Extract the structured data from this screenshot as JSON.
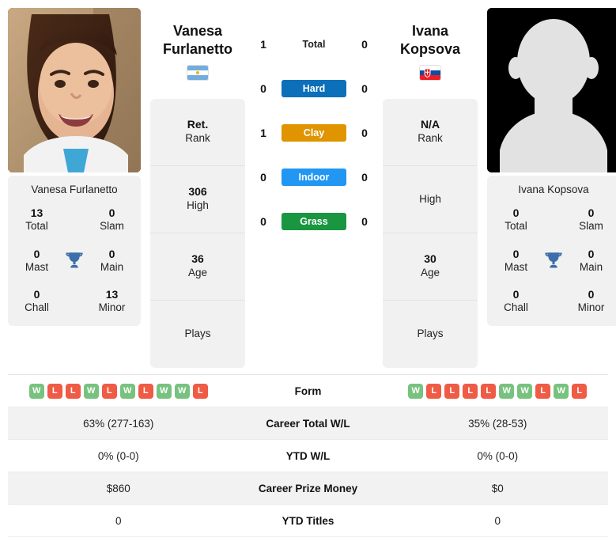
{
  "players": {
    "left": {
      "first_name": "Vanesa",
      "last_name": "Furlanetto",
      "full_name": "Vanesa Furlanetto",
      "country_flag_icon": "flag-argentina-icon",
      "photo_type": "player-photo",
      "rank": "Ret.",
      "rank_label": "Rank",
      "high": "306",
      "high_label": "High",
      "age": "36",
      "age_label": "Age",
      "plays": "",
      "plays_label": "Plays",
      "titles": {
        "total": "13",
        "total_label": "Total",
        "slam": "0",
        "slam_label": "Slam",
        "mast": "0",
        "mast_label": "Mast",
        "main": "0",
        "main_label": "Main",
        "chall": "0",
        "chall_label": "Chall",
        "minor": "13",
        "minor_label": "Minor"
      },
      "form": [
        "W",
        "L",
        "L",
        "W",
        "L",
        "W",
        "L",
        "W",
        "W",
        "L"
      ],
      "career_wl": "63% (277-163)",
      "ytd_wl": "0% (0-0)",
      "career_prize": "$860",
      "ytd_titles": "0"
    },
    "right": {
      "first_name": "Ivana",
      "last_name": "Kopsova",
      "full_name": "Ivana Kopsova",
      "country_flag_icon": "flag-slovakia-icon",
      "photo_type": "placeholder-avatar",
      "rank": "N/A",
      "rank_label": "Rank",
      "high": "",
      "high_label": "High",
      "age": "30",
      "age_label": "Age",
      "plays": "",
      "plays_label": "Plays",
      "titles": {
        "total": "0",
        "total_label": "Total",
        "slam": "0",
        "slam_label": "Slam",
        "mast": "0",
        "mast_label": "Mast",
        "main": "0",
        "main_label": "Main",
        "chall": "0",
        "chall_label": "Chall",
        "minor": "0",
        "minor_label": "Minor"
      },
      "form": [
        "W",
        "L",
        "L",
        "L",
        "L",
        "W",
        "W",
        "L",
        "W",
        "L"
      ],
      "career_wl": "35% (28-53)",
      "ytd_wl": "0% (0-0)",
      "career_prize": "$0",
      "ytd_titles": "0"
    }
  },
  "head_to_head": [
    {
      "label": "Total",
      "left": "1",
      "right": "0",
      "badge": false,
      "color": ""
    },
    {
      "label": "Hard",
      "left": "0",
      "right": "0",
      "badge": true,
      "color": "#0c6fba"
    },
    {
      "label": "Clay",
      "left": "1",
      "right": "0",
      "badge": true,
      "color": "#e09400"
    },
    {
      "label": "Indoor",
      "left": "0",
      "right": "0",
      "badge": true,
      "color": "#2196f3"
    },
    {
      "label": "Grass",
      "left": "0",
      "right": "0",
      "badge": true,
      "color": "#1a9641"
    }
  ],
  "table": {
    "rows": [
      {
        "label": "Form",
        "type": "form"
      },
      {
        "label": "Career Total W/L",
        "type": "text",
        "key": "career_wl"
      },
      {
        "label": "YTD W/L",
        "type": "text",
        "key": "ytd_wl"
      },
      {
        "label": "Career Prize Money",
        "type": "text",
        "key": "career_prize"
      },
      {
        "label": "YTD Titles",
        "type": "text",
        "key": "ytd_titles"
      }
    ]
  },
  "icons": {
    "trophy": "trophy-icon"
  },
  "colors": {
    "win": "#78c27f",
    "loss": "#ef5b45",
    "trophy": "#3c6eab",
    "panel_bg": "#f1f1f1",
    "row_alt_bg": "#f2f2f2"
  }
}
